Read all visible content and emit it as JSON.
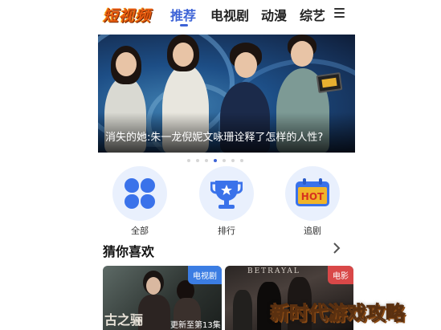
{
  "header": {
    "logo_text": "短视频",
    "tabs": [
      {
        "label": "推荐",
        "active": true
      },
      {
        "label": "电视剧",
        "active": false
      },
      {
        "label": "动漫",
        "active": false
      },
      {
        "label": "综艺",
        "active": false
      }
    ],
    "menu_icon": "hamburger-menu-icon"
  },
  "banner": {
    "title": "消失的她:朱一龙倪妮文咏珊诠释了怎样的人性?",
    "slide_count": 7,
    "active_slide": 3
  },
  "categories": [
    {
      "label": "全部",
      "icon": "grid-icon"
    },
    {
      "label": "排行",
      "icon": "trophy-icon"
    },
    {
      "label": "追剧",
      "icon": "hot-calendar-icon",
      "icon_text": "HOT"
    }
  ],
  "section": {
    "title": "猜你喜欢",
    "arrow_icon": "chevron-right-icon"
  },
  "cards": [
    {
      "badge": "电视剧",
      "show_text": "古之骊",
      "subtitle": "更新至第13集"
    },
    {
      "badge": "电影",
      "title_text": "BETRAYAL"
    }
  ],
  "watermark": "新时代游戏攻略",
  "colors": {
    "accent": "#3d63d6",
    "category_bg": "#e9f0fd",
    "badge_tv": "#3b7de3",
    "badge_movie": "#d94848"
  }
}
